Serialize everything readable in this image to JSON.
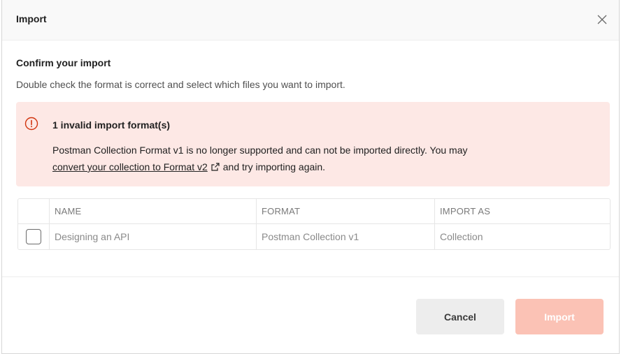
{
  "dialog": {
    "title": "Import",
    "close_icon": "close-icon"
  },
  "confirm": {
    "title": "Confirm your import",
    "subtitle": "Double check the format is correct and select which files you want to import."
  },
  "alert": {
    "icon": "error-circle-icon",
    "title": "1 invalid import format(s)",
    "body_text": "Postman Collection Format v1 is no longer supported and can not be imported directly. You may",
    "link_text": "convert your collection to Format v2",
    "link_icon": "external-link-icon",
    "body_suffix": "and try importing again.",
    "background_color": "#fde8e5"
  },
  "table": {
    "headers": [
      "NAME",
      "FORMAT",
      "IMPORT AS"
    ],
    "rows": [
      {
        "checked": false,
        "name": "Designing an API",
        "format": "Postman Collection v1",
        "import_as": "Collection"
      }
    ]
  },
  "footer": {
    "cancel_label": "Cancel",
    "import_label": "Import",
    "import_color": "#fbc2b5"
  }
}
